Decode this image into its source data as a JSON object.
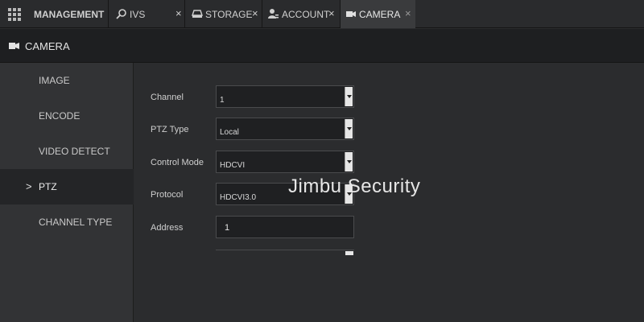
{
  "topbar": {
    "management_label": "MANAGEMENT",
    "tabs": [
      {
        "label": "IVS",
        "icon": "ivs-icon",
        "close": "×",
        "active": false
      },
      {
        "label": "STORAGE",
        "icon": "storage-icon",
        "close": "×",
        "active": false
      },
      {
        "label": "ACCOUNT",
        "icon": "account-icon",
        "close": "×",
        "active": false
      },
      {
        "label": "CAMERA",
        "icon": "camera-icon",
        "close": "×",
        "active": true
      }
    ]
  },
  "header": {
    "title": "CAMERA",
    "icon": "camera-icon"
  },
  "sidebar": {
    "items": [
      {
        "label": "IMAGE",
        "active": false
      },
      {
        "label": "ENCODE",
        "active": false
      },
      {
        "label": "VIDEO DETECT",
        "active": false
      },
      {
        "label": "PTZ",
        "active": true,
        "marker": ">"
      },
      {
        "label": "CHANNEL TYPE",
        "active": false
      }
    ]
  },
  "form": {
    "channel": {
      "label": "Channel",
      "value": "1"
    },
    "ptz_type": {
      "label": "PTZ Type",
      "value": "Local"
    },
    "control_mode": {
      "label": "Control Mode",
      "value": "HDCVI"
    },
    "protocol": {
      "label": "Protocol",
      "value": "HDCVI3.0"
    },
    "address": {
      "label": "Address",
      "value": "1"
    }
  },
  "watermark": "Jimbu  Security",
  "colors": {
    "active_tab": "#3a3b3d",
    "sidebar_active": "#242527",
    "background": "#2b2c2e"
  }
}
